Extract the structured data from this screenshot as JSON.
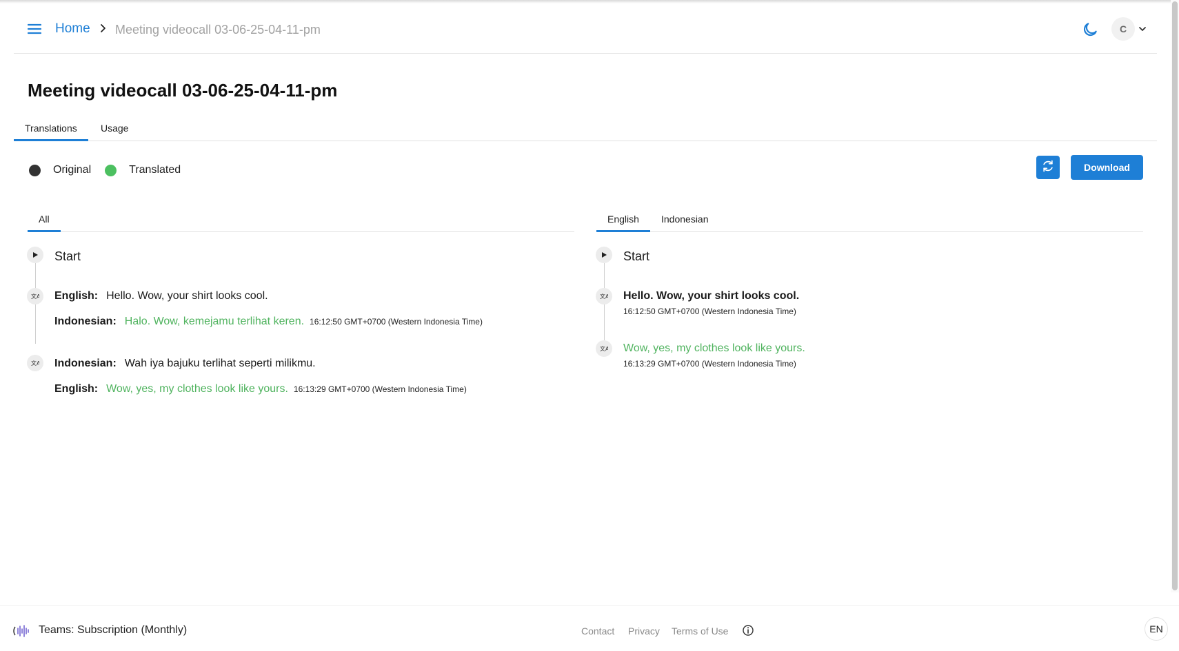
{
  "header": {
    "breadcrumb": {
      "home": "Home",
      "current": "Meeting videocall 03-06-25-04-11-pm"
    },
    "avatar_initial": "C"
  },
  "page_title": "Meeting videocall 03-06-25-04-11-pm",
  "main_tabs": [
    {
      "label": "Translations",
      "active": true
    },
    {
      "label": "Usage",
      "active": false
    }
  ],
  "legend": {
    "original": {
      "label": "Original",
      "color": "#333333"
    },
    "translated": {
      "label": "Translated",
      "color": "#4cc060"
    }
  },
  "toolbar": {
    "download_label": "Download"
  },
  "left_panel": {
    "tabs": [
      {
        "label": "All",
        "active": true
      }
    ],
    "start_label": "Start",
    "entries": [
      {
        "original_lang": "English:",
        "original_text": "Hello. Wow, your shirt looks cool.",
        "translated_lang": "Indonesian:",
        "translated_text": "Halo. Wow, kemejamu terlihat keren.",
        "timestamp": "16:12:50 GMT+0700 (Western Indonesia Time)"
      },
      {
        "original_lang": "Indonesian:",
        "original_text": "Wah iya bajuku terlihat seperti milikmu.",
        "translated_lang": "English:",
        "translated_text": "Wow, yes, my clothes look like yours.",
        "timestamp": "16:13:29 GMT+0700 (Western Indonesia Time)"
      }
    ]
  },
  "right_panel": {
    "tabs": [
      {
        "label": "English",
        "active": true
      },
      {
        "label": "Indonesian",
        "active": false
      }
    ],
    "start_label": "Start",
    "entries": [
      {
        "text": "Hello. Wow, your shirt looks cool.",
        "timestamp": "16:12:50 GMT+0700 (Western Indonesia Time)",
        "type": "original"
      },
      {
        "text": "Wow, yes, my clothes look like yours.",
        "timestamp": "16:13:29 GMT+0700 (Western Indonesia Time)",
        "type": "translated"
      }
    ]
  },
  "footer": {
    "plan": "Teams: Subscription (Monthly)",
    "links": [
      "Contact",
      "Privacy",
      "Terms of Use"
    ],
    "language": "EN"
  },
  "icons": {
    "menu": "hamburger-menu-icon",
    "breadcrumb_separator": "chevron-right-icon",
    "theme": "moon-icon",
    "avatar_dropdown": "chevron-down-icon",
    "refresh": "refresh-icon",
    "play": "play-icon",
    "translate": "translate-icon",
    "info": "info-icon",
    "logo": "soundwave-logo-icon"
  }
}
